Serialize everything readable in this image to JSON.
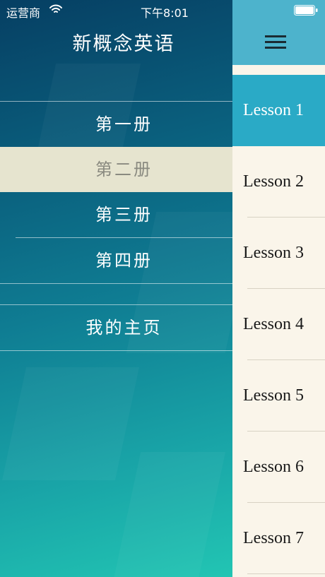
{
  "status_bar": {
    "carrier": "运营商",
    "time": "下午8:01"
  },
  "app": {
    "title": "新概念英语"
  },
  "menu": {
    "items": [
      {
        "label": "第一册"
      },
      {
        "label": "第二册",
        "selected": true
      },
      {
        "label": "第三册"
      },
      {
        "label": "第四册"
      },
      {
        "label": "我的主页"
      }
    ]
  },
  "lessons": {
    "items": [
      {
        "label": "Lesson 1",
        "active": true
      },
      {
        "label": "Lesson 2"
      },
      {
        "label": "Lesson 3"
      },
      {
        "label": "Lesson 4"
      },
      {
        "label": "Lesson 5"
      },
      {
        "label": "Lesson 6"
      },
      {
        "label": "Lesson 7"
      }
    ]
  },
  "icons": {
    "wifi": "wifi-icon",
    "battery": "battery-icon",
    "menu": "hamburger-menu-icon"
  },
  "colors": {
    "nav_bar": "#4db3cc",
    "active_lesson": "#2aaac6",
    "selected_menu": "#e6e4cf",
    "lesson_background": "#faf5ea"
  }
}
